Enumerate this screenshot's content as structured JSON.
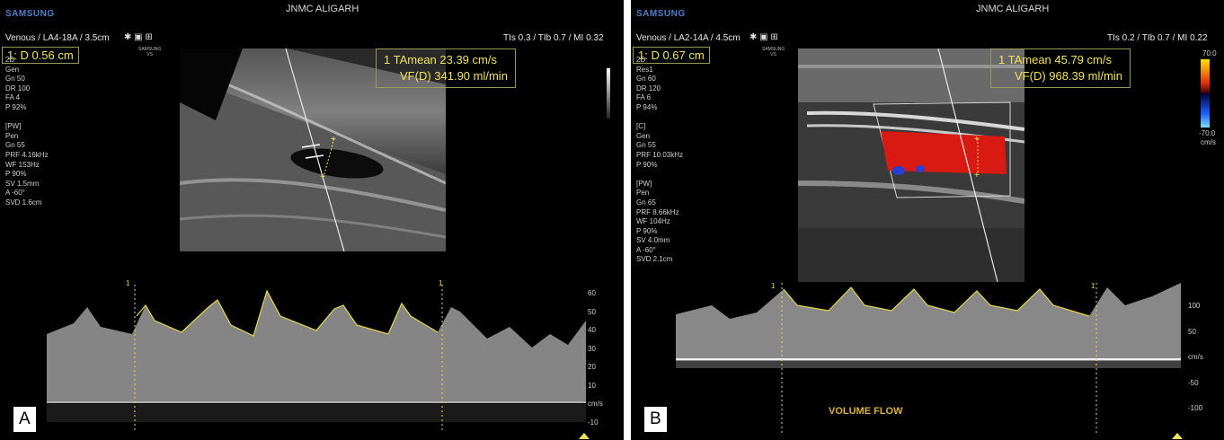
{
  "panels": [
    {
      "id": "A",
      "brand": "SAMSUNG",
      "hospital": "JNMC ALIGARH",
      "probe": "Venous / LA4-18A / 3.5cm",
      "tis": "TIs  0.3 / TIb  0.7 / MI  0.32",
      "distance": "1: D  0.56 cm",
      "measure": {
        "row1": "1  TAmean    23.39 cm/s",
        "row2": "VF(D)     341.90 ml/min"
      },
      "params": [
        "2D",
        "Gen",
        "Gn  50",
        "DR  100",
        "FA  4",
        "P  92%",
        "",
        "[PW]",
        "Pen",
        "Gn  55",
        "PRF  4.16kHz",
        "WF  153Hz",
        "P  90%",
        "SV  1.5mm",
        "A  -60°",
        "SVD  1.6cm"
      ],
      "scale_ticks": [
        "60",
        "50",
        "40",
        "30",
        "20",
        "10",
        "cm/s",
        "-10"
      ],
      "gate_marker": "1",
      "tag": "A",
      "volume_flow": ""
    },
    {
      "id": "B",
      "brand": "SAMSUNG",
      "hospital": "JNMC ALIGARH",
      "probe": "Venous / LA2-14A / 4.5cm",
      "tis": "TIs  0.2 / TIb  0.7 / MI  0.22",
      "distance": "1: D  0.67 cm",
      "measure": {
        "row1": "1  TAmean     45.79 cm/s",
        "row2": "VF(D)     968.39 ml/min"
      },
      "params": [
        "2D",
        "Res1",
        "Gn  60",
        "DR  120",
        "FA  6",
        "P  94%",
        "",
        "[C]",
        "Gen",
        "Gn  55",
        "PRF  10.03kHz",
        "P  90%",
        "",
        "[PW]",
        "Pen",
        "Gn  65",
        "PRF  8.66kHz",
        "WF  104Hz",
        "P  90%",
        "SV  4.0mm",
        "A  -60°",
        "SVD  2.1cm"
      ],
      "scale_ticks": [
        "100",
        "50",
        "cm/s",
        "-50",
        "-100"
      ],
      "color_scale": {
        "top": "70.0",
        "bottom": "-70.0",
        "unit": "cm/s"
      },
      "gate_marker": "1",
      "tag": "B",
      "volume_flow": "VOLUME FLOW"
    }
  ],
  "colors": {
    "measurement": "#f0e35c",
    "brand": "#4d7fc7",
    "doppler_flow": "#d81a12",
    "volume_flow": "#d8b23a"
  }
}
